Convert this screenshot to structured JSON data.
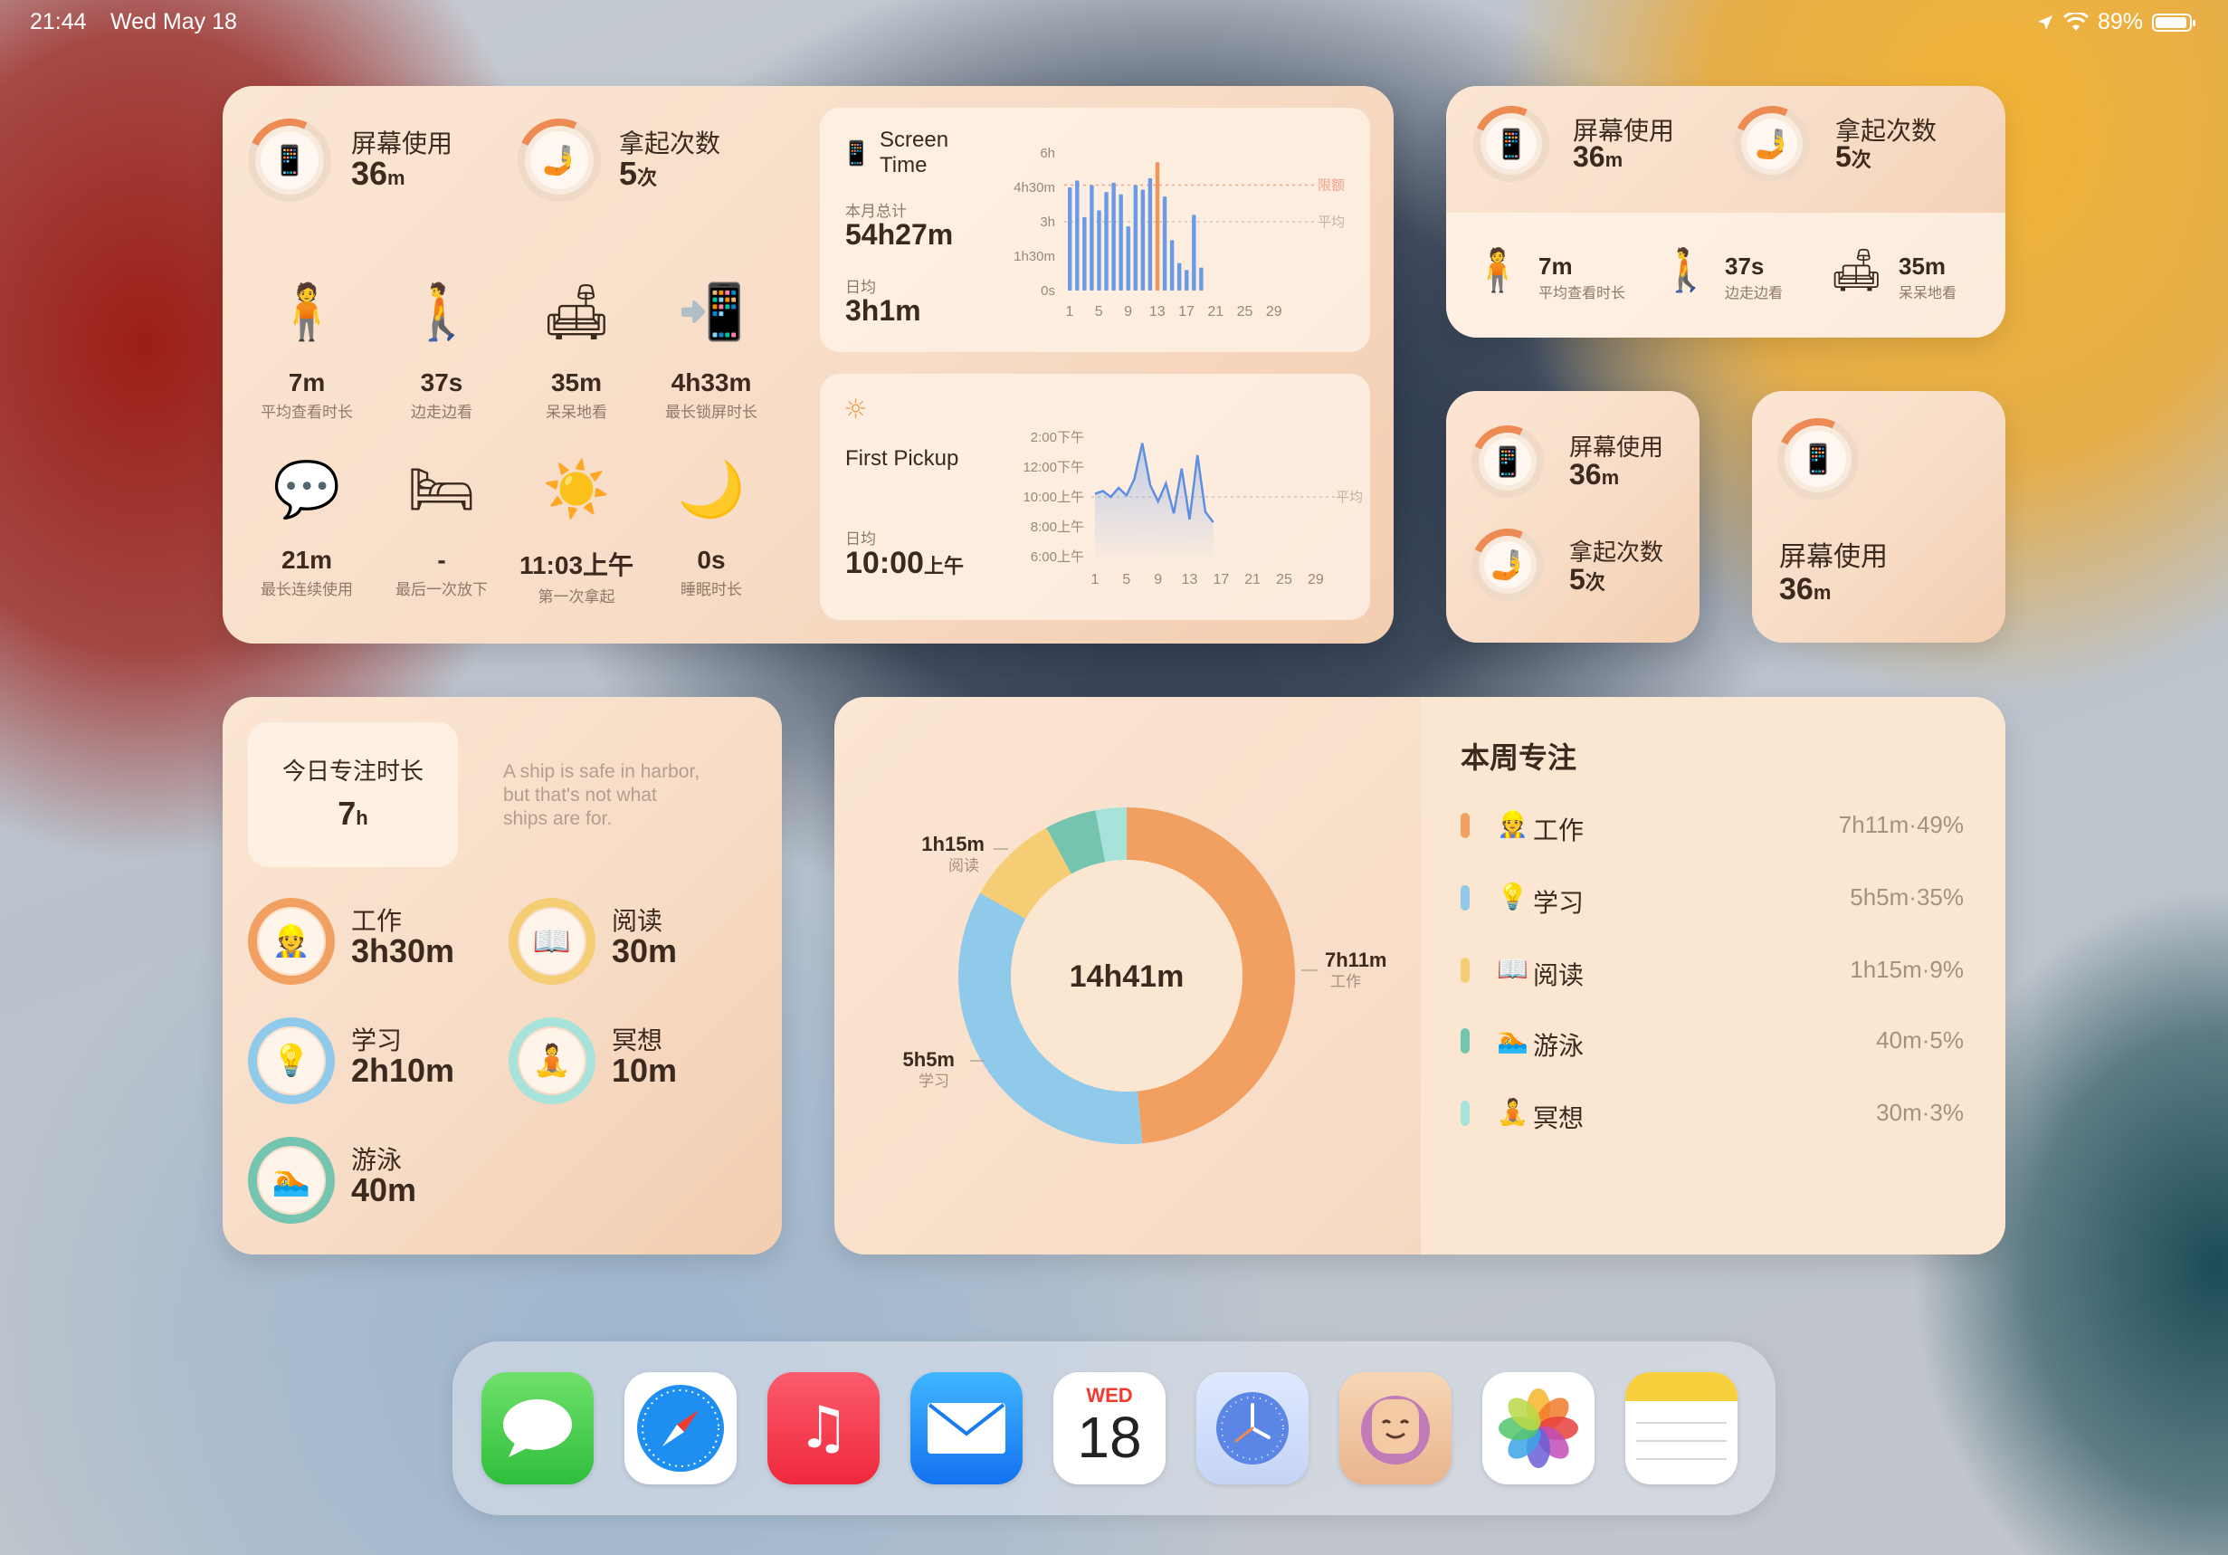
{
  "status_bar": {
    "time": "21:44",
    "date": "Wed May 18",
    "battery": "89%"
  },
  "big_widget": {
    "screen_use_label": "屏幕使用",
    "screen_use_value": "36",
    "screen_use_unit": "m",
    "pickups_label": "拿起次数",
    "pickups_value": "5",
    "pickups_unit": "次",
    "stats": [
      {
        "value": "7m",
        "caption": "平均查看时长",
        "icon": "reading-person-icon"
      },
      {
        "value": "37s",
        "caption": "边走边看",
        "icon": "walking-person-icon"
      },
      {
        "value": "35m",
        "caption": "呆呆地看",
        "icon": "lounging-person-icon"
      },
      {
        "value": "4h33m",
        "caption": "最长锁屏时长",
        "icon": "locked-phone-icon"
      },
      {
        "value": "21m",
        "caption": "最长连续使用",
        "icon": "chat-phone-icon"
      },
      {
        "value": "-",
        "caption": "最后一次放下",
        "icon": "bed-icon"
      },
      {
        "value": "11:03上午",
        "caption": "第一次拿起",
        "icon": "sun-icon"
      },
      {
        "value": "0s",
        "caption": "睡眠时长",
        "icon": "moon-icon"
      }
    ],
    "screen_time": {
      "title_line1": "Screen",
      "title_line2": "Time",
      "month_total_label": "本月总计",
      "month_total_value": "54h27m",
      "daily_avg_label": "日均",
      "daily_avg_value": "3h1m",
      "limit_label": "限额",
      "avg_label": "平均"
    },
    "first_pickup": {
      "title": "First Pickup",
      "daily_avg_label": "日均",
      "value": "10:00",
      "value_suffix": "上午",
      "avg_label": "平均"
    }
  },
  "chart_data": [
    {
      "type": "bar",
      "title": "Screen Time",
      "yticks": [
        "6h",
        "4h30m",
        "3h",
        "1h30m",
        "0s"
      ],
      "xticks": [
        "1",
        "5",
        "9",
        "13",
        "17",
        "21",
        "25",
        "29"
      ],
      "ylim": [
        0,
        6
      ],
      "values": [
        4.5,
        4.8,
        3.2,
        4.6,
        3.5,
        4.3,
        4.7,
        4.2,
        2.8,
        4.6,
        4.4,
        4.9,
        5.6,
        4.1,
        2.2,
        1.2,
        0.9,
        3.3,
        1.0
      ]
    },
    {
      "type": "line",
      "title": "First Pickup",
      "yticks": [
        "2:00下午",
        "12:00下午",
        "10:00上午",
        "8:00上午",
        "6:00上午"
      ],
      "xticks": [
        "1",
        "5",
        "9",
        "13",
        "17",
        "21",
        "25",
        "29"
      ],
      "values": [
        10.2,
        10.4,
        10.0,
        10.6,
        10.1,
        11.2,
        13.6,
        10.8,
        9.7,
        10.9,
        8.9,
        11.9,
        8.5,
        12.8,
        9.0,
        8.3
      ]
    },
    {
      "type": "pie",
      "center_label": "14h41m",
      "categories": [
        "工作",
        "学习",
        "阅读",
        "游泳",
        "冥想"
      ],
      "values": [
        49,
        35,
        9,
        5,
        3
      ],
      "colors": [
        "#f2a062",
        "#8fcaeb",
        "#f5cd74",
        "#74c4b0",
        "#a8e3db"
      ],
      "annotations": [
        {
          "value": "7h11m",
          "label": "工作"
        },
        {
          "value": "5h5m",
          "label": "学习"
        },
        {
          "value": "1h15m",
          "label": "阅读"
        }
      ]
    }
  ],
  "medium_widget": {
    "screen_use_label": "屏幕使用",
    "screen_use_value": "36",
    "screen_use_unit": "m",
    "pickups_label": "拿起次数",
    "pickups_value": "5",
    "pickups_unit": "次",
    "stats": [
      {
        "value": "7m",
        "caption": "平均查看时长"
      },
      {
        "value": "37s",
        "caption": "边走边看"
      },
      {
        "value": "35m",
        "caption": "呆呆地看"
      }
    ]
  },
  "small_widget_a": {
    "screen_use_label": "屏幕使用",
    "screen_use_value": "36",
    "screen_use_unit": "m",
    "pickups_label": "拿起次数",
    "pickups_value": "5",
    "pickups_unit": "次"
  },
  "small_widget_b": {
    "label": "屏幕使用",
    "value": "36",
    "unit": "m"
  },
  "focus_widget": {
    "today_label": "今日专注时长",
    "today_value": "7",
    "today_unit": "h",
    "quote_line1": "A ship is safe in harbor,",
    "quote_line2": "but that's not what",
    "quote_line3": "ships are for.",
    "items": [
      {
        "name": "工作",
        "value": "3h30m",
        "color": "#f2a062",
        "emoji": "👷"
      },
      {
        "name": "阅读",
        "value": "30m",
        "color": "#f5cd74",
        "emoji": "📖"
      },
      {
        "name": "学习",
        "value": "2h10m",
        "color": "#8fcaeb",
        "emoji": "💡"
      },
      {
        "name": "冥想",
        "value": "10m",
        "color": "#a8e3db",
        "emoji": "🧘"
      },
      {
        "name": "游泳",
        "value": "40m",
        "color": "#74c4b0",
        "emoji": "🏊"
      }
    ]
  },
  "week_widget": {
    "title": "本周专注",
    "rows": [
      {
        "name": "工作",
        "pct": "7h11m·49%",
        "color": "#f2a062",
        "emoji": "👷"
      },
      {
        "name": "学习",
        "pct": "5h5m·35%",
        "color": "#8fcaeb",
        "emoji": "💡"
      },
      {
        "name": "阅读",
        "pct": "1h15m·9%",
        "color": "#f5cd74",
        "emoji": "📖"
      },
      {
        "name": "游泳",
        "pct": "40m·5%",
        "color": "#74c4b0",
        "emoji": "🏊"
      },
      {
        "name": "冥想",
        "pct": "30m·3%",
        "color": "#a8e3db",
        "emoji": "🧘"
      }
    ]
  },
  "dock": {
    "apps": [
      "Messages",
      "Safari",
      "Music",
      "Mail",
      "Calendar",
      "Clock",
      "Pawnote",
      "Photos",
      "Notes"
    ],
    "calendar_day": "WED",
    "calendar_date": "18"
  }
}
